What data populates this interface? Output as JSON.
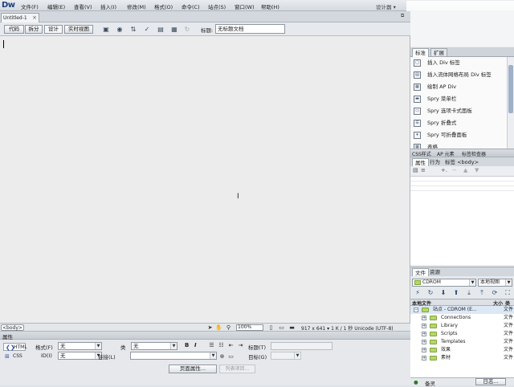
{
  "app": {
    "logo": "Dw",
    "designer": "设计器 ▾"
  },
  "menu": [
    "文件(F)",
    "编辑(E)",
    "查看(V)",
    "插入(I)",
    "修改(M)",
    "格式(O)",
    "命令(C)",
    "站点(S)",
    "窗口(W)",
    "帮助(H)"
  ],
  "doc_tab": {
    "label": "Untitled-1",
    "close": "×"
  },
  "toolbar": {
    "code": "代码",
    "split": "拆分",
    "design": "设计",
    "live": "实时视图",
    "title_label": "标题:",
    "title_value": "无标题文档"
  },
  "statusbar": {
    "tag": "<body>",
    "zoom": "100%",
    "info": "917 x 641 ▾ 1 K / 1 秒  Unicode (UTF-8)"
  },
  "properties": {
    "header": "属性",
    "html_tab": "HTML",
    "css_tab": "CSS",
    "format_label": "格式(F)",
    "format_value": "无",
    "id_label": "ID(I)",
    "id_value": "无",
    "class_label": "类",
    "class_value": "无",
    "link_label": "链接(L)",
    "bold": "B",
    "italic": "I",
    "title_label": "标题(T)",
    "target_label": "目标(G)",
    "page_props": "页面属性...",
    "list_item": "列表项目..."
  },
  "insert_panel": {
    "tabs": [
      "标准",
      "扩展"
    ],
    "items": [
      "插入 Div 标签",
      "插入流体网格布局 Div 标签",
      "绘制 AP Div",
      "Spry 菜单栏",
      "Spry 选项卡式面板",
      "Spry 折叠式",
      "Spry 可折叠面板",
      "表格"
    ]
  },
  "css_bar": {
    "tabs": [
      "CSS样式",
      "AP 元素",
      "标签检查器"
    ]
  },
  "attr_panel": {
    "tabs": [
      "属性",
      "行为"
    ],
    "tag_label": "标签 <body>"
  },
  "files_panel": {
    "tabs": [
      "文件",
      "资源"
    ],
    "site": "CDROM",
    "view": "本地视图",
    "col_local": "本地文件",
    "col_size": "大小",
    "col_type": "类",
    "tree": [
      {
        "label": "站点 - CDROM (E...",
        "kind": "文件",
        "level": 0,
        "root": true
      },
      {
        "label": "Connections",
        "kind": "文件",
        "level": 1
      },
      {
        "label": "Library",
        "kind": "文件",
        "level": 1
      },
      {
        "label": "Scripts",
        "kind": "文件",
        "level": 1
      },
      {
        "label": "Templates",
        "kind": "文件",
        "level": 1
      },
      {
        "label": "效果",
        "kind": "文件",
        "level": 1
      },
      {
        "label": "素材",
        "kind": "文件",
        "level": 1
      }
    ],
    "status": "备灵",
    "log": "日志..."
  }
}
